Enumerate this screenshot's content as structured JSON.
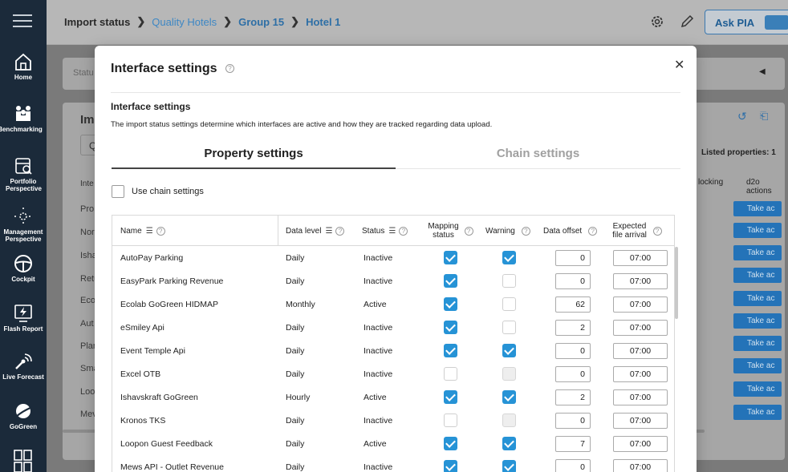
{
  "sidebar": {
    "items": [
      {
        "label": "Home",
        "icon": "home-icon"
      },
      {
        "label": "Benchmarking",
        "icon": "benchmarking-icon"
      },
      {
        "label": "Portfolio Perspective",
        "icon": "portfolio-icon"
      },
      {
        "label": "Management Perspective",
        "icon": "management-icon"
      },
      {
        "label": "Cockpit",
        "icon": "cockpit-icon"
      },
      {
        "label": "Flash Report",
        "icon": "flash-report-icon"
      },
      {
        "label": "Live Forecast",
        "icon": "live-forecast-icon"
      },
      {
        "label": "GoGreen",
        "icon": "gogreen-icon"
      }
    ]
  },
  "topbar": {
    "breadcrumb": [
      "Import status",
      "Quality Hotels",
      "Group 15",
      "Hotel 1"
    ],
    "ask_label": "Ask PIA"
  },
  "background": {
    "status_placeholder": "Statu",
    "heading_fragment": "Im",
    "search_fragment": "Q",
    "col_fragment": "Inte",
    "listed": "Listed properties: 1",
    "col_blocking": "locking",
    "col_actions": "d2o actions",
    "row_fragments": [
      "Pro",
      "Nor",
      "Isha",
      "Retu",
      "Eco",
      "Aut",
      "Plar",
      "Sma",
      "Loo",
      "Mev"
    ],
    "take_action": "Take ac"
  },
  "modal": {
    "title": "Interface settings",
    "section_title": "Interface settings",
    "description": "The import status settings determine which interfaces are active and how they are tracked regarding data upload.",
    "tabs": [
      "Property settings",
      "Chain settings"
    ],
    "use_chain_label": "Use chain settings",
    "columns": {
      "name": "Name",
      "data_level": "Data level",
      "status": "Status",
      "mapping": "Mapping status",
      "warning": "Warning",
      "offset": "Data offset",
      "arrival": "Expected file arrival"
    },
    "rows": [
      {
        "name": "AutoPay Parking",
        "level": "Daily",
        "status": "Inactive",
        "mapping": "on",
        "warning": "on",
        "offset": "0",
        "arrival": "07:00"
      },
      {
        "name": "EasyPark Parking Revenue",
        "level": "Daily",
        "status": "Inactive",
        "mapping": "on",
        "warning": "off",
        "offset": "0",
        "arrival": "07:00"
      },
      {
        "name": "Ecolab GoGreen HIDMAP",
        "level": "Monthly",
        "status": "Active",
        "mapping": "on",
        "warning": "off",
        "offset": "62",
        "arrival": "07:00"
      },
      {
        "name": "eSmiley Api",
        "level": "Daily",
        "status": "Inactive",
        "mapping": "on",
        "warning": "off",
        "offset": "2",
        "arrival": "07:00"
      },
      {
        "name": "Event Temple Api",
        "level": "Daily",
        "status": "Inactive",
        "mapping": "on",
        "warning": "on",
        "offset": "0",
        "arrival": "07:00"
      },
      {
        "name": "Excel OTB",
        "level": "Daily",
        "status": "Inactive",
        "mapping": "off",
        "warning": "dis",
        "offset": "0",
        "arrival": "07:00"
      },
      {
        "name": "Ishavskraft GoGreen",
        "level": "Hourly",
        "status": "Active",
        "mapping": "on",
        "warning": "on",
        "offset": "2",
        "arrival": "07:00"
      },
      {
        "name": "Kronos TKS",
        "level": "Daily",
        "status": "Inactive",
        "mapping": "off",
        "warning": "dis",
        "offset": "0",
        "arrival": "07:00"
      },
      {
        "name": "Loopon Guest Feedback",
        "level": "Daily",
        "status": "Active",
        "mapping": "on",
        "warning": "on",
        "offset": "7",
        "arrival": "07:00"
      },
      {
        "name": "Mews API - Outlet Revenue",
        "level": "Daily",
        "status": "Inactive",
        "mapping": "on",
        "warning": "on",
        "offset": "0",
        "arrival": "07:00"
      }
    ]
  },
  "colors": {
    "sidebar_bg": "#1b2a3a",
    "accent": "#2693d6",
    "link": "#3d87c4"
  }
}
